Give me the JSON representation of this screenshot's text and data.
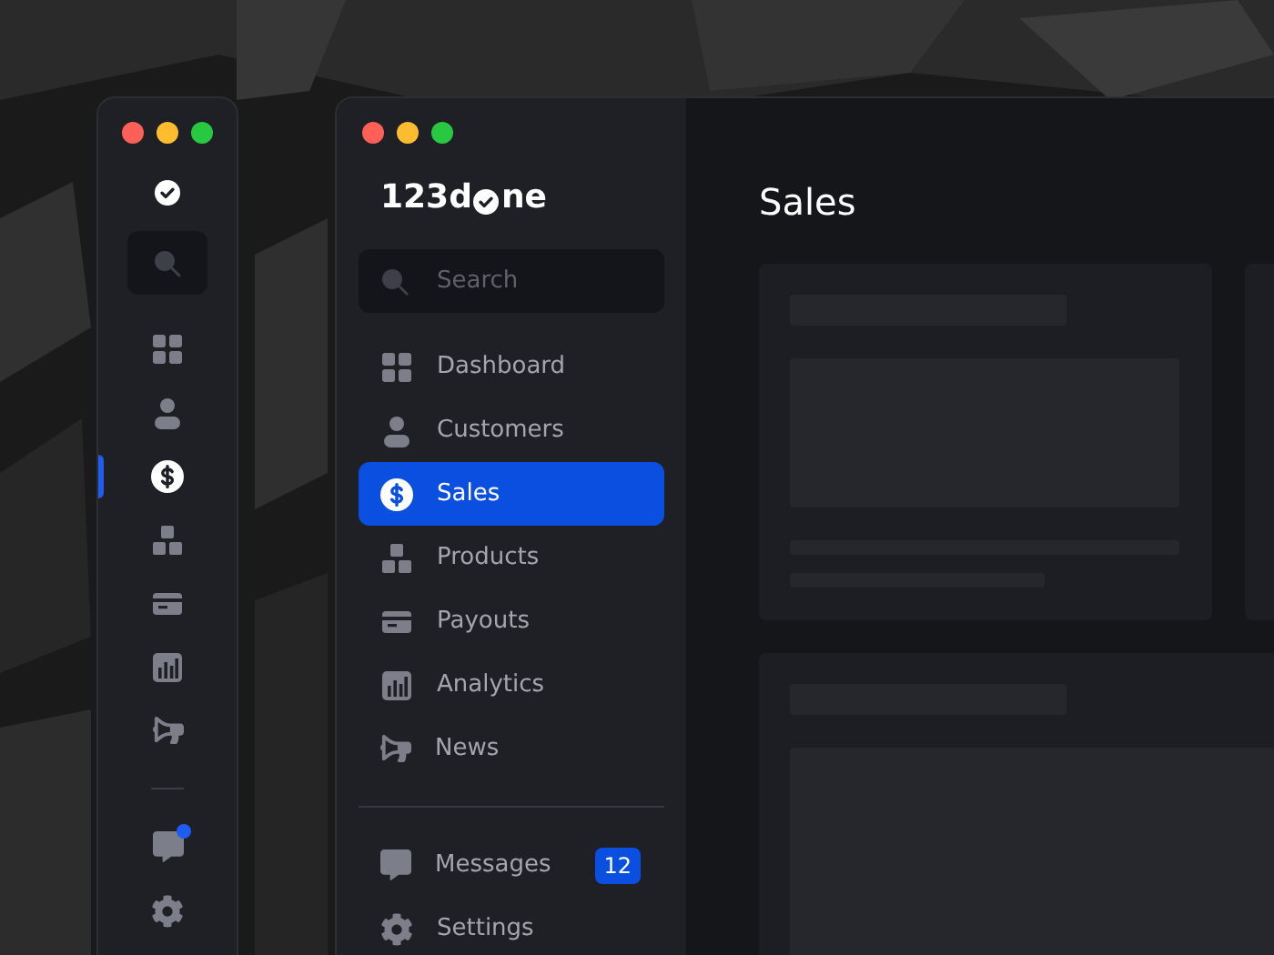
{
  "compact_window": {
    "nav": [
      {
        "selected": false
      },
      {
        "selected": false
      },
      {
        "selected": true
      },
      {
        "selected": false
      },
      {
        "selected": false
      },
      {
        "selected": false
      },
      {
        "selected": false
      }
    ],
    "footer": [
      {
        "unread": true
      },
      {
        "unread": false
      }
    ]
  },
  "main_window": {
    "logo": {
      "before": "123d",
      "after": "ne"
    },
    "search": {
      "placeholder": "Search"
    },
    "nav": [
      {
        "label": "Dashboard",
        "selected": false
      },
      {
        "label": "Customers",
        "selected": false
      },
      {
        "label": "Sales",
        "selected": true
      },
      {
        "label": "Products",
        "selected": false
      },
      {
        "label": "Payouts",
        "selected": false
      },
      {
        "label": "Analytics",
        "selected": false
      },
      {
        "label": "News",
        "selected": false
      }
    ],
    "footer": [
      {
        "label": "Messages",
        "badge": "12"
      },
      {
        "label": "Settings"
      }
    ],
    "page_title": "Sales"
  }
}
